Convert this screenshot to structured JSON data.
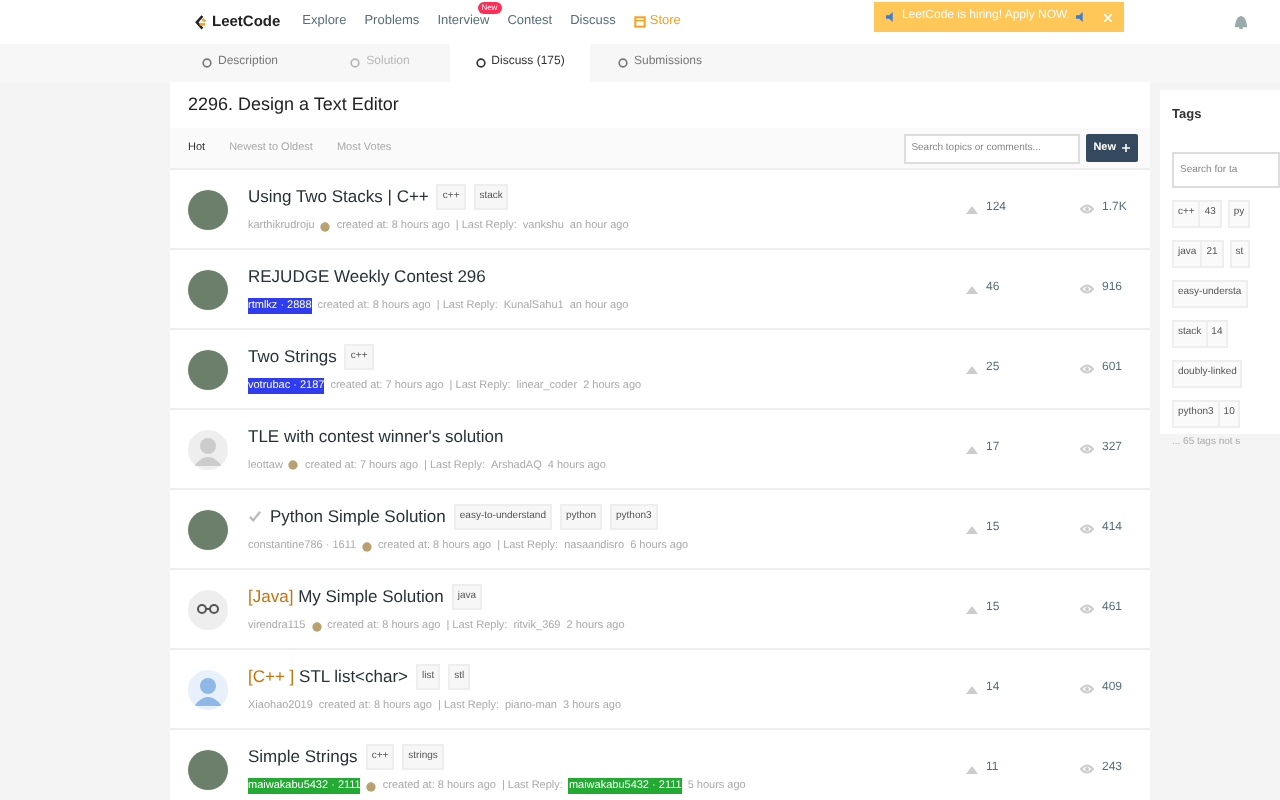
{
  "nav": {
    "logo": "LeetCode",
    "links": [
      {
        "label": "Explore",
        "kind": "plain"
      },
      {
        "label": "Problems",
        "kind": "plain"
      },
      {
        "label": "Interview",
        "kind": "plain",
        "badge": "New"
      },
      {
        "label": "Contest",
        "kind": "plain"
      },
      {
        "label": "Discuss",
        "kind": "plain"
      },
      {
        "label": "Store",
        "kind": "store"
      }
    ],
    "banner": "LeetCode is hiring! Apply NOW."
  },
  "tabs": [
    {
      "label": "Description",
      "selected": false,
      "disabled": false
    },
    {
      "label": "Solution",
      "selected": false,
      "disabled": true
    },
    {
      "label": "Discuss (175)",
      "selected": true,
      "disabled": false
    },
    {
      "label": "Submissions",
      "selected": false,
      "disabled": false
    }
  ],
  "problem_title": "2296. Design a Text Editor",
  "sort_options": [
    {
      "label": "Hot",
      "selected": true
    },
    {
      "label": "Newest to Oldest",
      "selected": false
    },
    {
      "label": "Most Votes",
      "selected": false
    }
  ],
  "search": {
    "placeholder": "Search topics or comments..."
  },
  "new_button": "New",
  "topics": [
    {
      "avatar": {
        "kind": "photo"
      },
      "solution_mark": false,
      "title": "Using Two Stacks | C++",
      "tags": [
        "c++",
        "stack"
      ],
      "author": {
        "name": "karthikrudroju"
      },
      "author_icon": true,
      "created": "created at: 8 hours ago",
      "reply_label": "| Last Reply:",
      "last_reply": {
        "name": "vankshu"
      },
      "reply_time": "an hour ago",
      "votes": "124",
      "views": "1.7K"
    },
    {
      "avatar": {
        "kind": "photo"
      },
      "solution_mark": false,
      "title": "REJUDGE Weekly Contest 296",
      "author": {
        "name": "rtmlkz · 2888",
        "color": "#2f3cf0"
      },
      "author_icon": false,
      "created": "created at: 8 hours ago",
      "reply_label": "| Last Reply:",
      "last_reply": {
        "name": "KunalSahu1"
      },
      "reply_time": "an hour ago",
      "votes": "46",
      "views": "916"
    },
    {
      "avatar": {
        "kind": "photo"
      },
      "solution_mark": false,
      "title": "Two Strings",
      "tags": [
        "c++"
      ],
      "author": {
        "name": "votrubac · 2187",
        "color": "#2f3cf0"
      },
      "author_icon": false,
      "created": "created at: 7 hours ago",
      "reply_label": "| Last Reply:",
      "last_reply": {
        "name": "linear_coder"
      },
      "reply_time": "2 hours ago",
      "votes": "25",
      "views": "601"
    },
    {
      "avatar": {
        "kind": "silhouette"
      },
      "solution_mark": false,
      "title": "TLE with contest winner's solution",
      "author": {
        "name": "leottaw"
      },
      "author_icon": true,
      "created": "created at: 7 hours ago",
      "reply_label": "| Last Reply:",
      "last_reply": {
        "name": "ArshadAQ"
      },
      "reply_time": "4 hours ago",
      "votes": "17",
      "views": "327"
    },
    {
      "avatar": {
        "kind": "photo"
      },
      "solution_mark": true,
      "title": "Python Simple Solution",
      "tags": [
        "easy-to-understand",
        "python",
        "python3"
      ],
      "author": {
        "name": "constantine786 · 1611"
      },
      "author_icon": true,
      "created": "created at: 8 hours ago",
      "reply_label": "| Last Reply:",
      "last_reply": {
        "name": "nasaandisro"
      },
      "reply_time": "6 hours ago",
      "votes": "15",
      "views": "414"
    },
    {
      "avatar": {
        "kind": "glasses"
      },
      "solution_mark": false,
      "prefix": "[Java]",
      "title": "My Simple Solution",
      "tags": [
        "java"
      ],
      "author": {
        "name": "virendra115"
      },
      "author_icon": true,
      "created": "created at: 8 hours ago",
      "reply_label": "| Last Reply:",
      "last_reply": {
        "name": "ritvik_369"
      },
      "reply_time": "2 hours ago",
      "votes": "15",
      "views": "461"
    },
    {
      "avatar": {
        "kind": "person"
      },
      "solution_mark": false,
      "prefix": "[C++ ]",
      "title": "STL list<char>",
      "tags": [
        "list",
        "stl"
      ],
      "author": {
        "name": "Xiaohao2019"
      },
      "author_icon": false,
      "created": "created at: 8 hours ago",
      "reply_label": "| Last Reply:",
      "last_reply": {
        "name": "piano-man"
      },
      "reply_time": "3 hours ago",
      "votes": "14",
      "views": "409"
    },
    {
      "avatar": {
        "kind": "photo"
      },
      "solution_mark": false,
      "title": "Simple Strings",
      "tags": [
        "c++",
        "strings"
      ],
      "author": {
        "name": "maiwakabu5432 · 2111",
        "color": "#22aa33"
      },
      "author_icon": true,
      "created": "created at: 8 hours ago",
      "reply_label": "| Last Reply:",
      "last_reply": {
        "name": "maiwakabu5432 · 2111",
        "color": "#22aa33"
      },
      "reply_time": "5 hours ago",
      "votes": "11",
      "views": "243"
    }
  ],
  "tags_panel": {
    "title": "Tags",
    "search_placeholder": "Search for ta",
    "rows": [
      [
        {
          "name": "c++",
          "count": "43"
        },
        {
          "name": "py"
        }
      ],
      [
        {
          "name": "java",
          "count": "21"
        },
        {
          "name": "st"
        }
      ],
      [
        {
          "name": "easy-understa"
        }
      ],
      [
        {
          "name": "stack",
          "count": "14"
        }
      ],
      [
        {
          "name": "doubly-linked"
        }
      ],
      [
        {
          "name": "python3",
          "count": "10"
        }
      ]
    ],
    "footer": "... 65 tags not s"
  }
}
